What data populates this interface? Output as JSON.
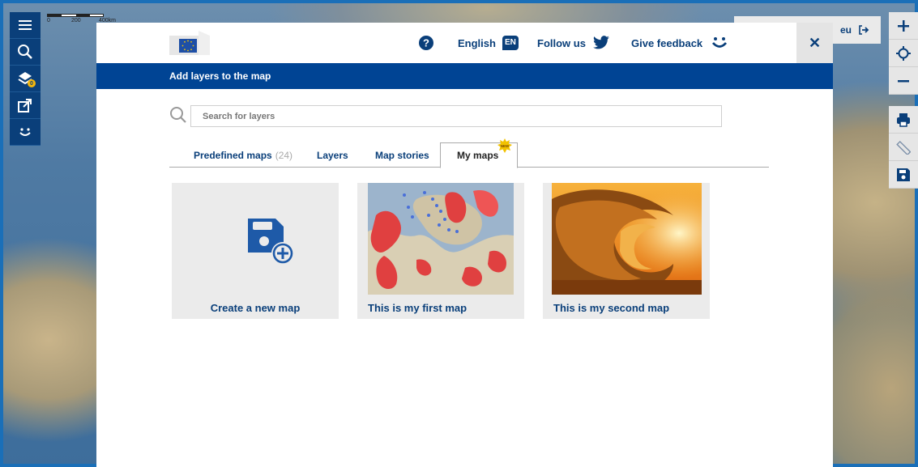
{
  "scale_bar": {
    "labels": [
      "0",
      "200",
      "400km"
    ]
  },
  "left_toolbar": {
    "items": [
      {
        "name": "menu-icon"
      },
      {
        "name": "search-icon"
      },
      {
        "name": "layers-icon",
        "badge": "0"
      },
      {
        "name": "share-icon"
      },
      {
        "name": "smile-icon"
      }
    ]
  },
  "right_toolbar": {
    "items": [
      "plus-icon",
      "crosshair-icon",
      "minus-icon",
      "print-icon",
      "ruler-icon",
      "save-icon"
    ]
  },
  "behind_label": {
    "text": "eu"
  },
  "header": {
    "language": "English",
    "language_code": "EN",
    "follow_us": "Follow us",
    "give_feedback": "Give feedback",
    "close": "✕"
  },
  "title_bar": {
    "title": "Add layers to the map"
  },
  "search": {
    "placeholder": "Search for layers"
  },
  "tabs": [
    {
      "label": "Predefined maps",
      "count": "(24)"
    },
    {
      "label": "Layers"
    },
    {
      "label": "Map stories"
    },
    {
      "label": "My maps",
      "badge": "NEW"
    }
  ],
  "cards": [
    {
      "label": "Create a new map"
    },
    {
      "label": "This is my first map"
    },
    {
      "label": "This is my second map"
    }
  ],
  "colors": {
    "primary": "#004494",
    "dark_blue": "#0a3f7a",
    "accent": "#f2b50c",
    "card_bg": "#ebebeb"
  }
}
